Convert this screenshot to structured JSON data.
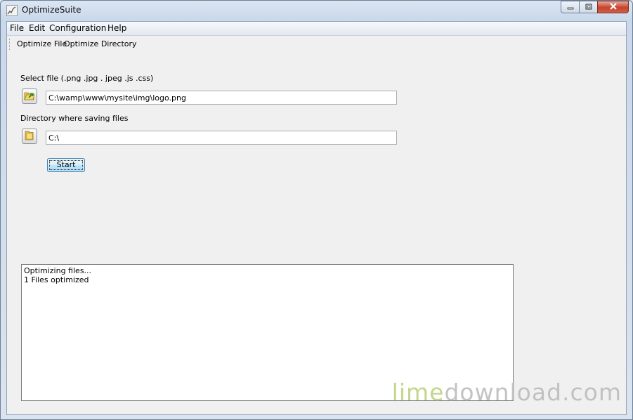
{
  "window": {
    "title": "OptimizeSuite",
    "controls": {
      "minimize_icon": "minimize-icon",
      "maximize_icon": "maximize-icon",
      "close_icon": "close-icon"
    }
  },
  "menubar": {
    "items": [
      {
        "label": "File"
      },
      {
        "label": "Edit"
      },
      {
        "label": "Configuration"
      },
      {
        "label": "Help"
      }
    ]
  },
  "toolbar": {
    "items": [
      {
        "label": "Optimize File"
      },
      {
        "label": "Optimize Directory"
      }
    ]
  },
  "form": {
    "select_file_label": "Select file (.png .jpg . jpeg .js .css)",
    "select_file_value": "C:\\wamp\\www\\mysite\\img\\logo.png",
    "select_file_icon": "open-file-icon",
    "directory_label": "Directory where saving files",
    "directory_value": "C:\\",
    "directory_icon": "folder-icon",
    "start_label": "Start"
  },
  "log": {
    "lines": [
      "Optimizing files...",
      "1 Files optimized"
    ]
  },
  "watermark": {
    "part1": "lime",
    "part2": "download.com"
  },
  "colors": {
    "accent": "#3c7fb1",
    "close": "#c7432b",
    "watermark_green": "#b8cf7a"
  }
}
